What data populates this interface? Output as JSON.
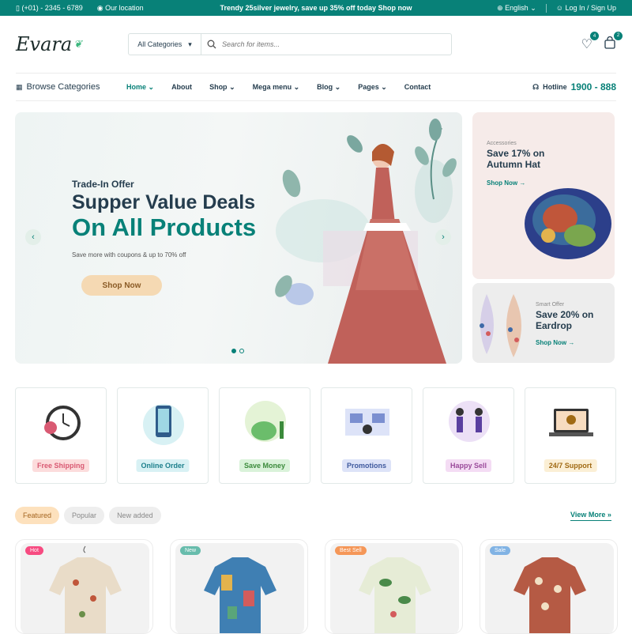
{
  "topbar": {
    "phone": "(+01) - 2345 - 6789",
    "location": "Our location",
    "promo": "Trendy 25silver jewelry, save up 35% off today Shop now",
    "language": "English",
    "login": "Log In / Sign Up"
  },
  "header": {
    "logo": "Evara",
    "category_select": "All Categories",
    "search_placeholder": "Search for items...",
    "wishlist_count": "4",
    "cart_count": "2"
  },
  "nav": {
    "browse": "Browse Categories",
    "links": [
      "Home",
      "About",
      "Shop",
      "Mega menu",
      "Blog",
      "Pages",
      "Contact"
    ],
    "hotline_label": "Hotline",
    "hotline_number": "1900 - 888"
  },
  "hero": {
    "tag": "Trade-In Offer",
    "title1": "Supper Value Deals",
    "title2": "On All Products",
    "subtitle": "Save more with coupons & up to 70% off",
    "button": "Shop Now"
  },
  "side_banners": [
    {
      "category": "Accessories",
      "title1": "Save 17% on",
      "title2": "Autumn Hat",
      "link": "Shop Now"
    },
    {
      "category": "Smart Offer",
      "title1": "Save 20% on",
      "title2": "Eardrop",
      "link": "Shop Now"
    }
  ],
  "features": [
    {
      "label": "Free Shipping",
      "color": "#fcdcdc",
      "text": "#d95a73"
    },
    {
      "label": "Online Order",
      "color": "#d8f1f4",
      "text": "#1c7f8c"
    },
    {
      "label": "Save Money",
      "color": "#d9f2d9",
      "text": "#3b8a3b"
    },
    {
      "label": "Promotions",
      "color": "#dde3f8",
      "text": "#3f5a9e"
    },
    {
      "label": "Happy Sell",
      "color": "#f4dcf4",
      "text": "#9a4a9a"
    },
    {
      "label": "24/7 Support",
      "color": "#fbefd5",
      "text": "#a06a14"
    }
  ],
  "tabs": [
    "Featured",
    "Popular",
    "New added"
  ],
  "view_more": "View More",
  "products": [
    {
      "badge": "Hot",
      "color": "#f74b81"
    },
    {
      "badge": "New",
      "color": "#67bcac"
    },
    {
      "badge": "Best Sell",
      "color": "#f59758"
    },
    {
      "badge": "Sale",
      "color": "#81b3e4"
    }
  ]
}
